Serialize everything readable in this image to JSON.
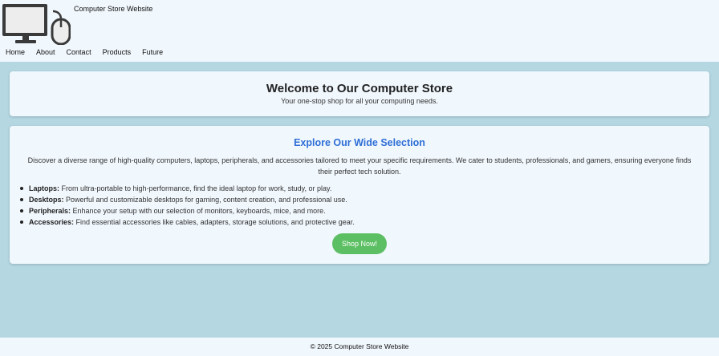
{
  "header": {
    "site_name": "Computer Store Website",
    "logo_icon": "computer-mouse-icon"
  },
  "nav": {
    "items": [
      "Home",
      "About",
      "Contact",
      "Products",
      "Future"
    ]
  },
  "hero": {
    "title": "Welcome to Our Computer Store",
    "subtitle": "Your one-stop shop for all your computing needs."
  },
  "main": {
    "title": "Explore Our Wide Selection",
    "description": "Discover a diverse range of high-quality computers, laptops, peripherals, and accessories tailored to meet your specific requirements. We cater to students, professionals, and gamers, ensuring everyone finds their perfect tech solution.",
    "features": [
      {
        "label": "Laptops:",
        "text": " From ultra-portable to high-performance, find the ideal laptop for work, study, or play."
      },
      {
        "label": "Desktops:",
        "text": " Powerful and customizable desktops for gaming, content creation, and professional use."
      },
      {
        "label": "Peripherals:",
        "text": " Enhance your setup with our selection of monitors, keyboards, mice, and more."
      },
      {
        "label": "Accessories:",
        "text": " Find essential accessories like cables, adapters, storage solutions, and protective gear."
      }
    ],
    "cta_label": "Shop Now!"
  },
  "footer": {
    "text": "© 2025 Computer Store Website"
  },
  "colors": {
    "page_background": "#b4d7e2",
    "card_background": "#f0f7fd",
    "accent_title": "#2f6fd6",
    "cta_button": "#5cbf63"
  }
}
